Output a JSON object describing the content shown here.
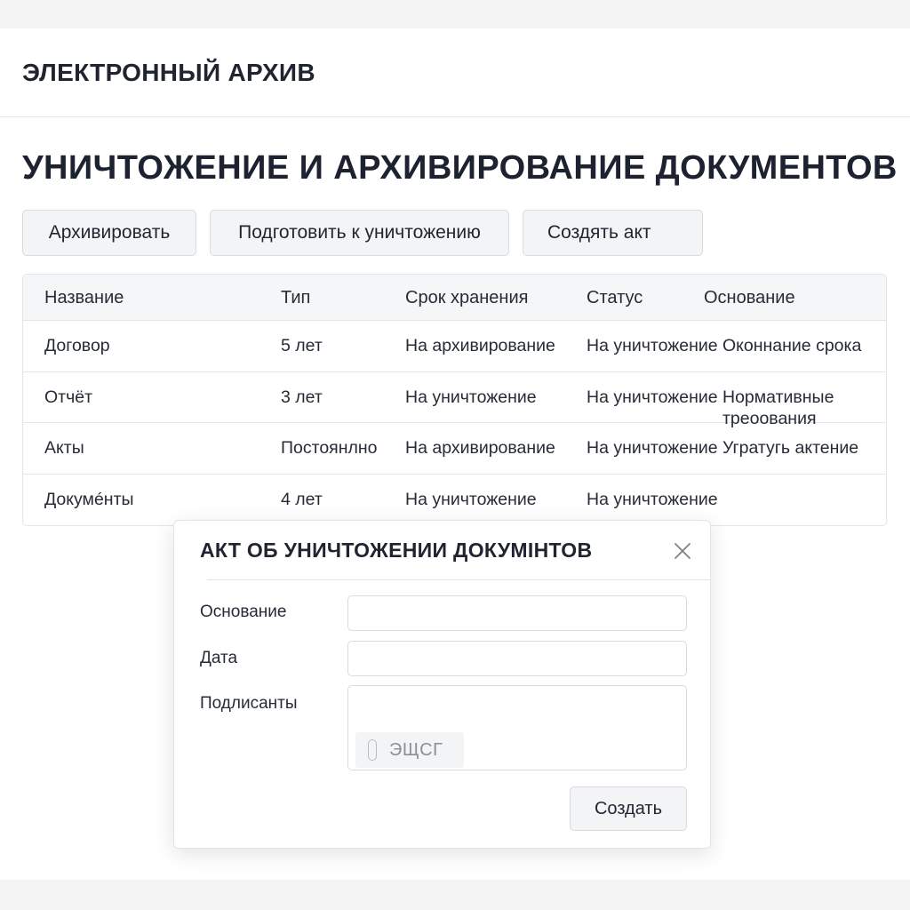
{
  "header": {
    "app_title": "ЭЛЕКТРОННЫЙ АРХИВ"
  },
  "page": {
    "title": "УНИЧТОЖЕНИЕ И АРХИВИРОВАНИЕ ДОКУМЕНТОВ"
  },
  "toolbar": {
    "archive_label": "Архивировать",
    "prepare_label": "Подготовить к уничтожению",
    "act_label": "Создять акт"
  },
  "table": {
    "columns": [
      "Название",
      "Тип",
      "Срок хранения",
      "Статус",
      "Основание"
    ],
    "rows": [
      [
        "Договор",
        "5 лет",
        "На архивирование",
        "На уничтожение",
        "Оконнание срока"
      ],
      [
        "Отчёт",
        "3 лет",
        "На уничтожение",
        "На уничтожение",
        "Нормативные треоования"
      ],
      [
        "Акты",
        "Постоянлно",
        "На архивирование",
        "На уничтожение",
        "Угратугь актение"
      ],
      [
        "Докумéнты",
        "4 лет",
        "На уничтожение",
        "На уничтожение",
        ""
      ]
    ]
  },
  "modal": {
    "title": "АКТ ОБ УНИЧТОЖЕНИИ ДОКУМІНТОВ",
    "fields": {
      "basis_label": "Основание",
      "basis_value": "",
      "date_label": "Дата",
      "date_value": "",
      "signers_label": "Подлисанты",
      "signer_chip": "ЭЩСГ"
    },
    "create_label": "Создать"
  },
  "icons": {
    "close": "close-icon",
    "chip": "paperclip-icon"
  },
  "colors": {
    "text": "#1f2430",
    "border": "#d9dbe0",
    "button_bg": "#f3f4f6",
    "header_row_bg": "#f5f6f8"
  }
}
